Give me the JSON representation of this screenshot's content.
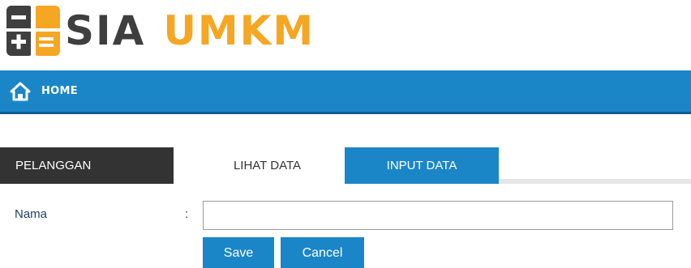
{
  "logo": {
    "text_primary": "SIA",
    "text_secondary": "UMKM",
    "colors": {
      "primary": "#3f3f3f",
      "secondary": "#f5a623",
      "icon_dark": "#3f3f3f",
      "icon_orange": "#f5a623"
    },
    "icon": "calculator-icon"
  },
  "nav": {
    "home_label": "HOME",
    "home_icon": "home-icon",
    "color": "#1a86c8"
  },
  "section": {
    "label": "PELANGGAN"
  },
  "tabs": [
    {
      "label": "LIHAT DATA",
      "active": false
    },
    {
      "label": "INPUT DATA",
      "active": true
    }
  ],
  "form": {
    "nama_label": "Nama",
    "colon": ":",
    "nama_value": "",
    "save_label": "Save",
    "cancel_label": "Cancel"
  }
}
